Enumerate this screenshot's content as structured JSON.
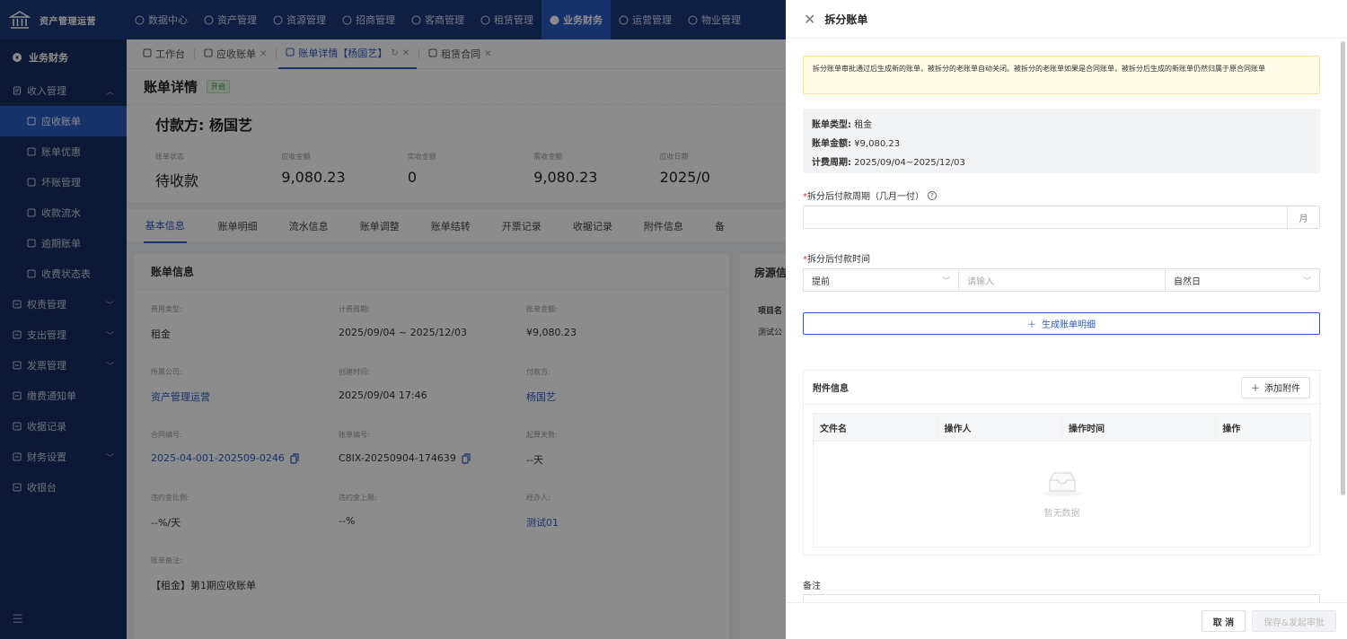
{
  "app": {
    "title": "资产管理运营"
  },
  "topnav": {
    "items": [
      {
        "label": "数据中心",
        "icon": "clock-icon"
      },
      {
        "label": "资产管理",
        "icon": "cube-icon"
      },
      {
        "label": "资源管理",
        "icon": "building-icon"
      },
      {
        "label": "招商管理",
        "icon": "diamond-icon"
      },
      {
        "label": "客商管理",
        "icon": "users-icon"
      },
      {
        "label": "租赁管理",
        "icon": "house-icon"
      },
      {
        "label": "业务财务",
        "icon": "coin-icon",
        "active": true
      },
      {
        "label": "运营管理",
        "icon": "chart-icon"
      },
      {
        "label": "物业管理",
        "icon": "tool-icon"
      }
    ]
  },
  "sidebar": {
    "head": "业务财务",
    "groups": [
      {
        "label": "收入管理",
        "expanded": true
      },
      {
        "label": "权责管理"
      },
      {
        "label": "支出管理"
      },
      {
        "label": "发票管理"
      },
      {
        "label": "缴费通知单"
      },
      {
        "label": "收据记录"
      },
      {
        "label": "财务设置"
      },
      {
        "label": "收银台"
      }
    ],
    "subitems": [
      {
        "label": "应收账单",
        "active": true
      },
      {
        "label": "账单优惠"
      },
      {
        "label": "坏账管理"
      },
      {
        "label": "收款流水"
      },
      {
        "label": "逾期账单"
      },
      {
        "label": "收费状态表"
      }
    ]
  },
  "tabs": [
    {
      "label": "工作台"
    },
    {
      "label": "应收账单"
    },
    {
      "label": "账单详情【杨国艺】",
      "active": true
    },
    {
      "label": "租赁合同"
    }
  ],
  "detail": {
    "title": "账单详情",
    "status_badge": "开启",
    "payer": "付款方: 杨国艺",
    "stats": [
      {
        "label": "账单状态",
        "value": "待收款"
      },
      {
        "label": "应收金额",
        "value": "9,080.23"
      },
      {
        "label": "实收金额",
        "value": "0"
      },
      {
        "label": "需收金额",
        "value": "9,080.23"
      },
      {
        "label": "应收日期",
        "value": "2025/0"
      }
    ],
    "subtabs": [
      "基本信息",
      "账单明细",
      "流水信息",
      "账单调整",
      "账单结转",
      "开票记录",
      "收据记录",
      "附件信息",
      "备"
    ],
    "card_title": "账单信息",
    "fields": [
      {
        "label": "费用类型:",
        "value": "租金"
      },
      {
        "label": "计费周期:",
        "value": "2025/09/04 ~ 2025/12/03"
      },
      {
        "label": "账单金额:",
        "value": "¥9,080.23"
      },
      {
        "label": "所属公司:",
        "value": "资产管理运营",
        "link": true
      },
      {
        "label": "创建时间:",
        "value": "2025/09/04 17:46"
      },
      {
        "label": "付款方:",
        "value": "杨国艺",
        "link": true
      },
      {
        "label": "合同编号:",
        "value": "2025-04-001-202509-0246",
        "link": true,
        "copy": true
      },
      {
        "label": "账单编号:",
        "value": "C8IX-20250904-174639",
        "copy": true
      },
      {
        "label": "起算天数:",
        "value": "--天"
      },
      {
        "label": "违约金比例:",
        "value": "--%/天"
      },
      {
        "label": "违约金上限:",
        "value": "--%"
      },
      {
        "label": "经办人:",
        "value": "测试01",
        "link": true
      }
    ],
    "note_label": "账单备注:",
    "note_value": "【租金】第1期应收账单",
    "right_title": "房源信",
    "right_row1": "项目名",
    "right_row2": "测试公"
  },
  "drawer": {
    "title": "拆分账单",
    "alert": "拆分账单审批通过后生成新的账单，被拆分的老账单自动关闭。被拆分的老账单如果是合同账单，被拆分后生成的新账单仍然归属于原合同账单",
    "info": {
      "type_label": "账单类型:",
      "type_value": "租金",
      "amount_label": "账单金额:",
      "amount_value": "¥9,080.23",
      "period_label": "计费周期:",
      "period_value": "2025/09/04~2025/12/03"
    },
    "period_field": {
      "label": "拆分后付款周期（几月一付）",
      "suffix": "月",
      "value": ""
    },
    "time_field": {
      "label": "拆分后付款时间",
      "mode": "提前",
      "placeholder": "请输入",
      "unit": "自然日"
    },
    "generate_label": "生成账单明细",
    "attachments": {
      "title": "附件信息",
      "add_label": "添加附件",
      "columns": [
        "文件名",
        "操作人",
        "操作时间",
        "操作"
      ],
      "empty_text": "暂无数据"
    },
    "remark_label": "备注",
    "cancel_label": "取 消",
    "submit_label": "保存&发起审批"
  },
  "colors": {
    "primary": "#2b59c3",
    "nav_bg": "#1a3a7a",
    "sidebar_bg": "#152f5f",
    "required": "#e03131"
  }
}
